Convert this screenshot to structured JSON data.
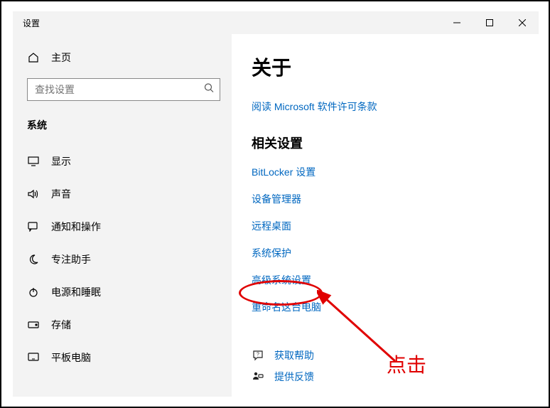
{
  "window": {
    "title": "设置"
  },
  "sidebar": {
    "home_label": "主页",
    "search_placeholder": "查找设置",
    "category_label": "系统",
    "items": [
      {
        "label": "显示"
      },
      {
        "label": "声音"
      },
      {
        "label": "通知和操作"
      },
      {
        "label": "专注助手"
      },
      {
        "label": "电源和睡眠"
      },
      {
        "label": "存储"
      },
      {
        "label": "平板电脑"
      }
    ]
  },
  "main": {
    "heading": "关于",
    "top_link": "阅读 Microsoft 软件许可条款",
    "related_title": "相关设置",
    "related_links": [
      "BitLocker 设置",
      "设备管理器",
      "远程桌面",
      "系统保护",
      "高级系统设置",
      "重命名这台电脑"
    ],
    "help": {
      "get_help": "获取帮助",
      "feedback": "提供反馈"
    }
  },
  "annotation": {
    "label": "点击"
  }
}
